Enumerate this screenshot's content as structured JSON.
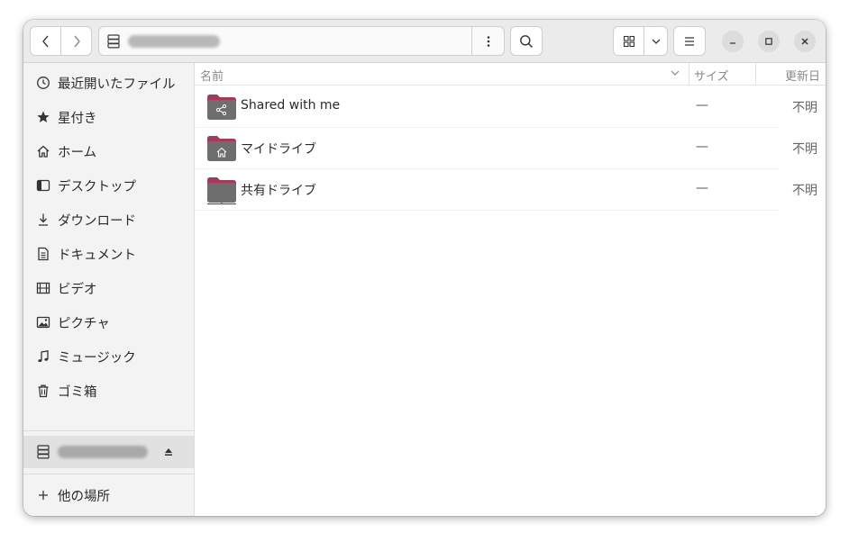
{
  "window": {
    "path_text": "████████"
  },
  "sidebar": {
    "items": [
      {
        "label": "最近開いたファイル",
        "icon": "clock-icon"
      },
      {
        "label": "星付き",
        "icon": "star-icon"
      },
      {
        "label": "ホーム",
        "icon": "home-icon"
      },
      {
        "label": "デスクトップ",
        "icon": "desktop-icon"
      },
      {
        "label": "ダウンロード",
        "icon": "download-icon"
      },
      {
        "label": "ドキュメント",
        "icon": "document-icon"
      },
      {
        "label": "ビデオ",
        "icon": "film-icon"
      },
      {
        "label": "ピクチャ",
        "icon": "picture-icon"
      },
      {
        "label": "ミュージック",
        "icon": "music-icon"
      },
      {
        "label": "ゴミ箱",
        "icon": "trash-icon"
      }
    ],
    "drive_label": "████████",
    "other_locations": "他の場所"
  },
  "columns": {
    "name": "名前",
    "size": "サイズ",
    "modified": "更新日"
  },
  "files": [
    {
      "name": "Shared with me",
      "size": "—",
      "modified": "不明",
      "emblem": "share-icon"
    },
    {
      "name": "マイドライブ",
      "size": "—",
      "modified": "不明",
      "emblem": "home-icon"
    },
    {
      "name": "共有ドライブ",
      "size": "—",
      "modified": "不明",
      "emblem": "drive-icon"
    }
  ],
  "colors": {
    "folder_top": "#a43a57",
    "folder_body": "#6e6e6e",
    "selected_bg": "#e1e1e1"
  }
}
